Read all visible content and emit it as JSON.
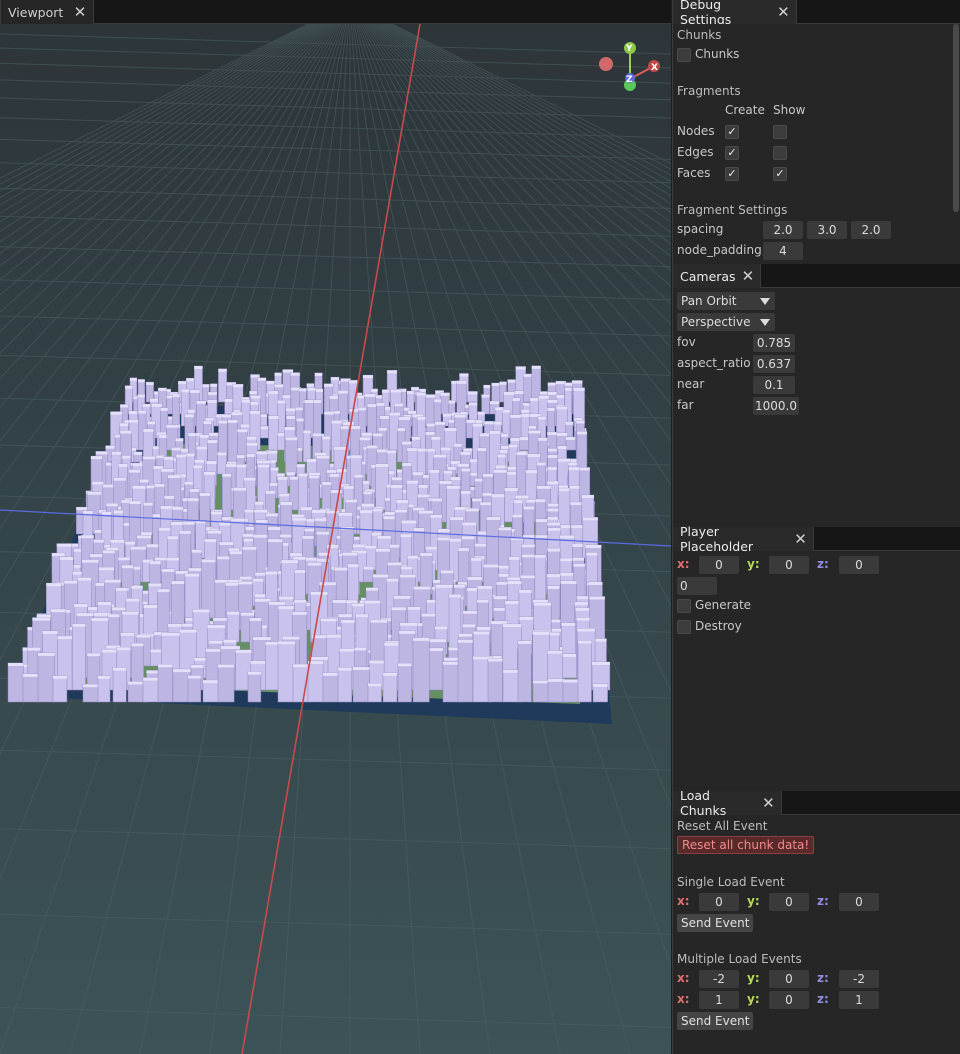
{
  "viewport": {
    "tab_label": "Viewport",
    "gizmo": {
      "x": "X",
      "y": "Y",
      "z": "Z"
    }
  },
  "debug": {
    "tab_label": "Debug Settings",
    "chunks_header": "Chunks",
    "chunks_label": "Chunks",
    "fragments_header": "Fragments",
    "col_create": "Create",
    "col_show": "Show",
    "rows": [
      {
        "label": "Nodes",
        "create": true,
        "show": false
      },
      {
        "label": "Edges",
        "create": true,
        "show": false
      },
      {
        "label": "Faces",
        "create": true,
        "show": true
      }
    ],
    "fragment_settings_header": "Fragment Settings",
    "spacing_label": "spacing",
    "spacing": [
      "2.0",
      "3.0",
      "2.0"
    ],
    "node_padding_label": "node_padding",
    "node_padding": "4"
  },
  "cameras": {
    "tab_label": "Cameras",
    "mode": "Pan Orbit",
    "projection": "Perspective",
    "fov_label": "fov",
    "fov": "0.785",
    "aspect_label": "aspect_ratio",
    "aspect": "0.637",
    "near_label": "near",
    "near": "0.1",
    "far_label": "far",
    "far": "1000.0"
  },
  "player": {
    "tab_label": "Player Placeholder",
    "x_label": "x:",
    "x": "0",
    "y_label": "y:",
    "y": "0",
    "z_label": "z:",
    "z": "0",
    "extra": "0",
    "generate_label": "Generate",
    "destroy_label": "Destroy"
  },
  "load": {
    "tab_label": "Load Chunks",
    "reset_header": "Reset All Event",
    "reset_button": "Reset all chunk data!",
    "single_header": "Single Load Event",
    "single": {
      "x": "0",
      "y": "0",
      "z": "0"
    },
    "send_label": "Send Event",
    "multiple_header": "Multiple Load Events",
    "multi": [
      {
        "x": "-2",
        "y": "0",
        "z": "-2"
      },
      {
        "x": "1",
        "y": "0",
        "z": "1"
      }
    ],
    "axis": {
      "x": "x:",
      "y": "y:",
      "z": "z:"
    }
  },
  "colors": {
    "accent_red": "#e07070",
    "accent_green": "#b6d85a",
    "accent_blue": "#8e8ee8",
    "cubes": "#c9c2ec",
    "grass": "#a8e070"
  }
}
